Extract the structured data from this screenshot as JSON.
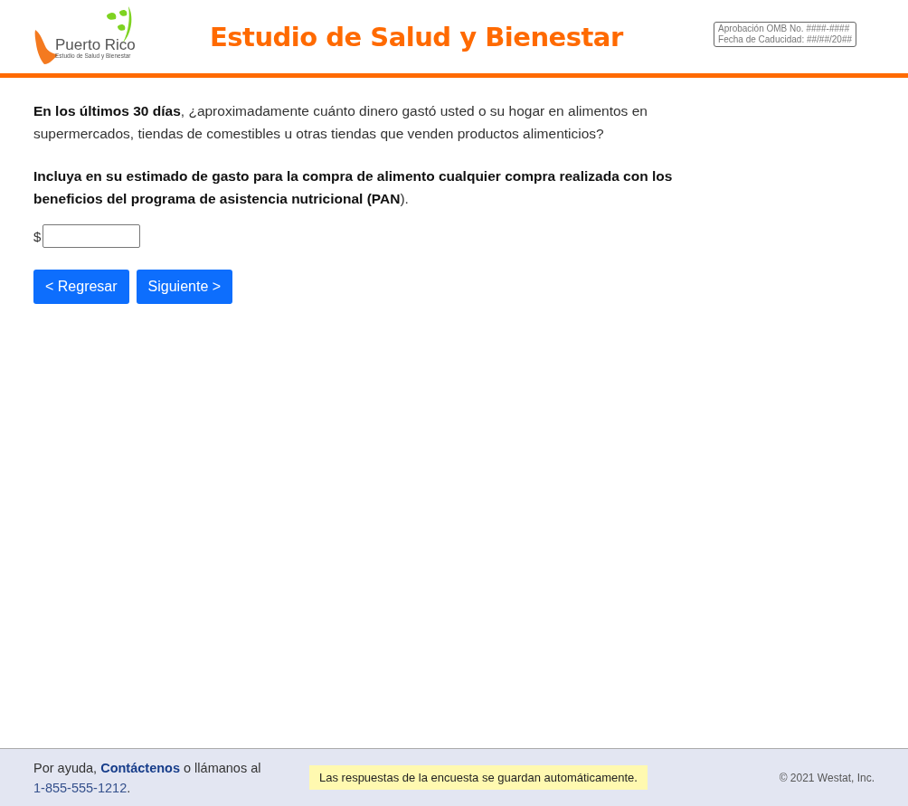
{
  "header": {
    "logo_title": "Puerto Rico",
    "logo_subtitle": "Estudio de Salud y Bienestar",
    "title": "Estudio de Salud y Bienestar",
    "omb": [
      "Aprobación OMB No. ####-####",
      "Fecha de Caducidad: ##/##/20##"
    ]
  },
  "question": {
    "text": "**En los últimos 30 días**, ¿aproximadamente cuánto dinero gastó usted o su hogar en alimentos en supermercados, tiendas de comestibles u otras tiendas que venden productos alimenticios?",
    "instruction": "**Incluya en su estimado de gasto para la compra de alimento cualquier compra realizada con los beneficios del programa de asistencia nutricional (PAN**).",
    "currency": "$"
  },
  "buttons": [
    {
      "label": "< Regresar"
    },
    {
      "label": "Siguiente >"
    }
  ],
  "footer": {
    "help_prefix": "Por ayuda, ",
    "help_link": "Contáctenos",
    "help_suffix": " o llámanos al",
    "phone": "1-855-555-1212",
    "phone_end": ".",
    "autosave": "Las respuestas de la encuesta se guardan automáticamente.",
    "copyright": "© 2021 Westat, Inc."
  }
}
